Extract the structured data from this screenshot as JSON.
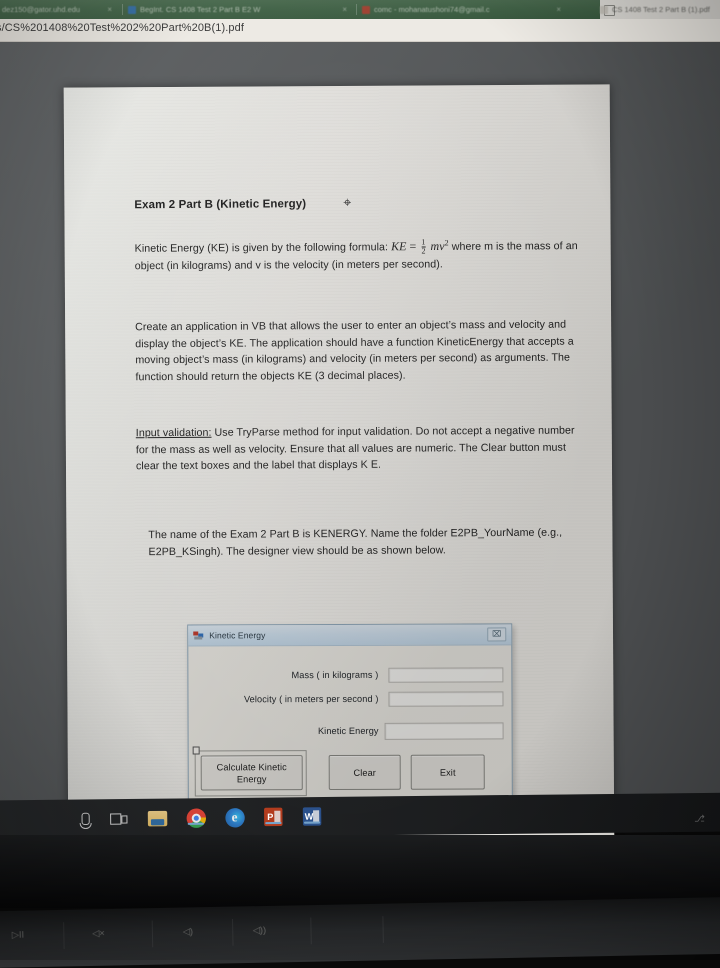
{
  "browser": {
    "tabs": [
      {
        "title": "dez150@gator.uhd.edu",
        "favicon": "grey-favicon",
        "close": "×"
      },
      {
        "title": "BegInt. CS 1408 Test 2 Part B   E2   W",
        "favicon": "blue-favicon",
        "close": "×"
      },
      {
        "title": "comc - mohanatushoni74@gmail.c",
        "favicon": "red-favicon",
        "close": "×"
      },
      {
        "title": "CS 1408 Test 2 Part B (1).pdf",
        "favicon": "pdf-favicon",
        "close": ""
      }
    ],
    "url": "s/CS%201408%20Test%202%20Part%20B(1).pdf"
  },
  "document": {
    "title": "Exam 2 Part B (Kinetic Energy)",
    "formula_paragraph": {
      "lead": "Kinetic Energy (KE) is given by the following formula:",
      "math_ke": "KE",
      "math_eq": "=",
      "frac_num": "1",
      "frac_den": "2",
      "math_mv2_m": "mv",
      "math_mv2_sup": "2",
      "tail": "where m is the mass of an object (in kilograms) and v is the velocity (in meters per second)."
    },
    "paragraph_2": "Create an application in VB that allows the user to enter an object’s mass and velocity and display the object’s KE. The application should have a function KineticEnergy that accepts a moving object’s mass (in kilograms) and velocity (in meters per second) as arguments. The function should return the objects KE (3 decimal places).",
    "paragraph_3_label": "Input validation:",
    "paragraph_3": " Use TryParse method for input validation. Do not accept a negative number for the mass as well as velocity. Ensure that all values are numeric. The Clear button must clear the text boxes and the label that displays K E.",
    "paragraph_4": "The name of the Exam 2 Part B is KENERGY. Name the folder E2PB_YourName (e.g., E2PB_KSingh).  The designer view should be as shown below."
  },
  "vb_form": {
    "window_title": "Kinetic Energy",
    "close_glyph": "⌧",
    "fields": [
      {
        "label": "Mass ( in kilograms )",
        "value": ""
      },
      {
        "label": "Velocity ( in meters per second )",
        "value": ""
      },
      {
        "label": "Kinetic Energy",
        "value": ""
      }
    ],
    "buttons": [
      {
        "label": "Calculate Kinetic Energy",
        "accesskey": "C"
      },
      {
        "label": "Clear",
        "accesskey": "a"
      },
      {
        "label": "Exit",
        "accesskey": "x"
      }
    ]
  },
  "taskbar": {
    "items": [
      {
        "name": "microphone-icon",
        "label": "Microphone"
      },
      {
        "name": "task-view-icon",
        "label": "Task View"
      },
      {
        "name": "file-explorer-icon",
        "label": "File Explorer"
      },
      {
        "name": "chrome-icon",
        "label": "Google Chrome",
        "active": true
      },
      {
        "name": "edge-icon",
        "label": "Microsoft Edge",
        "letter": "e"
      },
      {
        "name": "powerpoint-icon",
        "label": "PowerPoint",
        "letter": "P",
        "active": true
      },
      {
        "name": "word-icon",
        "label": "Word",
        "letter": "W",
        "active": true
      }
    ],
    "tray": "⎇"
  },
  "keyboard": {
    "fkeys": [
      "▷II",
      "◁×",
      "◁)",
      "◁))"
    ]
  },
  "colors": {
    "browser_chrome": "#3f6245",
    "pdf_background": "#5b5e60",
    "page": "#f2f0ec",
    "vb_titlebar": "#cfe0ee",
    "taskbar": "#1d1f21"
  }
}
